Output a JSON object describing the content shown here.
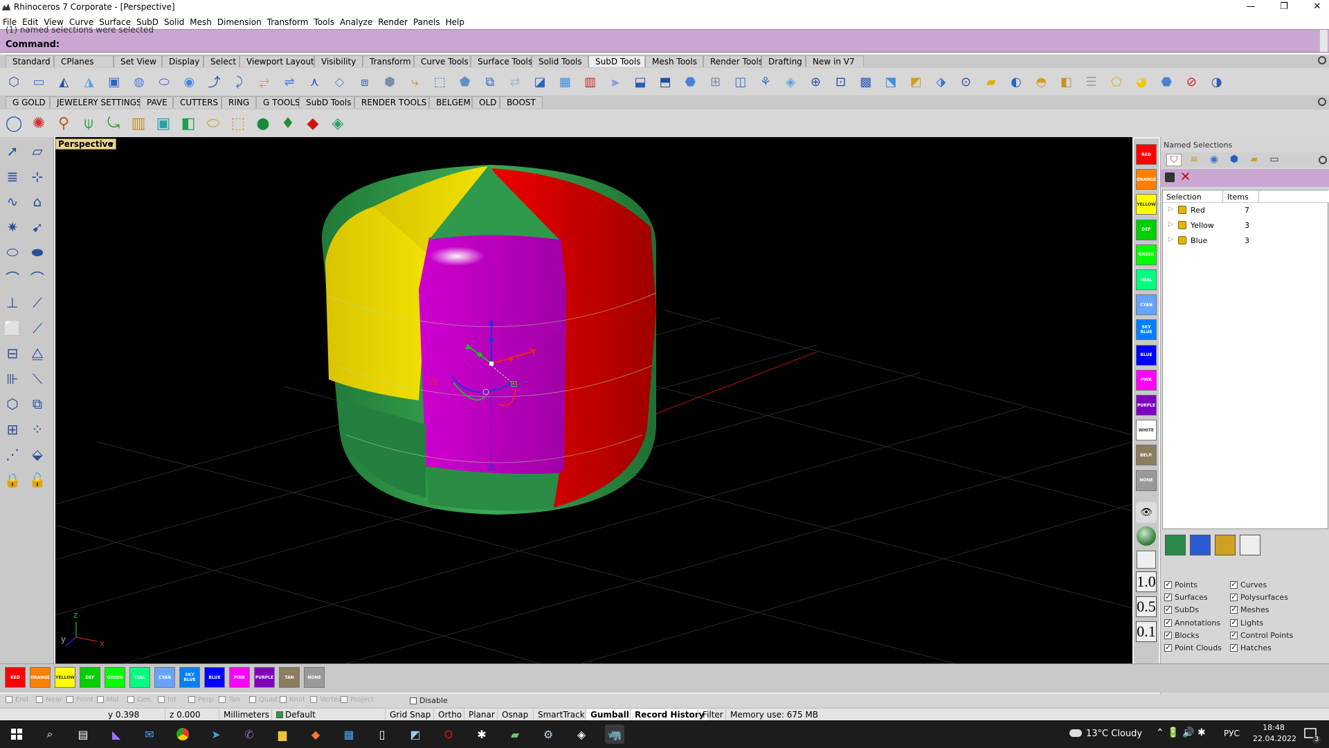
{
  "window": {
    "title": "Rhinoceros 7 Corporate - [Perspective]",
    "controls": [
      "—",
      "❐",
      "✕"
    ]
  },
  "menu": [
    "File",
    "Edit",
    "View",
    "Curve",
    "Surface",
    "SubD",
    "Solid",
    "Mesh",
    "Dimension",
    "Transform",
    "Tools",
    "Analyze",
    "Render",
    "Panels",
    "Help"
  ],
  "command": {
    "history": "(1) named selections were selected",
    "prompt": "Command:"
  },
  "toolbar_tabs_1": [
    "Standard",
    "CPlanes",
    "Set View",
    "Display",
    "Select",
    "Viewport Layout",
    "Visibility",
    "Transform",
    "Curve Tools",
    "Surface Tools",
    "Solid Tools",
    "SubD Tools",
    "Mesh Tools",
    "Render Tools",
    "Drafting",
    "New in V7"
  ],
  "toolbar_tabs_1_active": "SubD Tools",
  "toolbar_tabs_2": [
    "G GOLD",
    "JEWELERY SETTINGS",
    "PAVE",
    "CUTTERS",
    "RING",
    "G TOOLS",
    "SubD Tools",
    "RENDER TOOLS",
    "BELGEM",
    "OLD",
    "BOOST"
  ],
  "icon_row_1": [
    "subd-box-icon",
    "subd-plane-icon",
    "subd-cone-icon",
    "subd-pyramid-icon",
    "subd-cylinder-icon",
    "subd-sphere-icon",
    "subd-torus-icon",
    "subd-ellipsoid-icon",
    "subd-tube-icon",
    "subd-loft-icon",
    "subd-sweep-icon",
    "subd-pipe-icon",
    "subd-bridge-icon",
    "subd-crease-icon",
    "subd-box-smooth-icon",
    "subd-subdivide-icon",
    "subd-insert-edge-icon",
    "subd-fill-icon",
    "subd-stitch-icon",
    "subd-append-icon",
    "subd-mesh-icon",
    "subd-weld-icon",
    "subd-grid-icon",
    "subd-grid2-icon",
    "subd-transform-icon",
    "subd-extrude-icon",
    "subd-offset-icon",
    "subd-slide-icon",
    "subd-bevel-icon",
    "subd-symmetry-icon",
    "subd-patch-icon",
    "subd-reflect-icon",
    "subd-fill-hole-icon",
    "subd-grid3-icon",
    "subd-tools-icon",
    "subd-join-icon",
    "subd-unjoin-icon",
    "subd-merge-icon",
    "subd-box-display-icon",
    "subd-brush-icon",
    "subd-globe-icon",
    "subd-smooth-icon",
    "subd-paint-icon",
    "subd-stack-icon",
    "subd-face-icon",
    "subd-face2-icon",
    "subd-vertex-icon",
    "subd-no-icon",
    "subd-toggle-icon",
    "subd-bulge-icon"
  ],
  "icon_row_2": [
    "ring-icon",
    "bead-icon",
    "pin-icon",
    "prong-icon",
    "curve-tool-icon",
    "cylinder-gold-icon",
    "square-icon",
    "layers-icon",
    "oval-icon",
    "dotted-oval-icon",
    "sphere-green-icon",
    "gem-icon",
    "ruby-icon",
    "jewel-icon"
  ],
  "left_palette": [
    "select-arrow-icon",
    "eraser-icon",
    "layers-icon",
    "gumball-icon",
    "curve-icon",
    "surface-icon",
    "snap-icon",
    "move-icon",
    "ellipse-icon",
    "boolean-icon",
    "arc-icon",
    "arc2-icon",
    "line-icon",
    "bend-icon",
    "fillet-icon",
    "offset-icon",
    "trim-icon",
    "split-icon",
    "dimension-icon",
    "extend-icon",
    "polygon-icon",
    "array-icon",
    "grid-icon",
    "align-icon",
    "dim2-icon",
    "box2-icon",
    "lock-icon",
    "unlock-icon"
  ],
  "viewport": {
    "label": "Perspective",
    "dropdown_arrow": "▾",
    "axes": {
      "y": "y",
      "z": "z",
      "x": "x"
    },
    "colors": {
      "green": "#2e9a4b",
      "yellow": "#e6d100",
      "red": "#e00000",
      "magenta": "#cc00cc"
    }
  },
  "swatches_side": [
    {
      "label": "RED",
      "color": "#ff0000"
    },
    {
      "label": "ORANGE",
      "color": "#ff7f00"
    },
    {
      "label": "YELLOW",
      "color": "#ffff00"
    },
    {
      "label": "DEF",
      "color": "#00d000"
    },
    {
      "label": "GREEN",
      "color": "#00ff00"
    },
    {
      "label": "TEAL",
      "color": "#00ff80"
    },
    {
      "label": "CYAN",
      "color": "#66a3ff"
    },
    {
      "label": "SKY BLUE",
      "color": "#0080ff"
    },
    {
      "label": "BLUE",
      "color": "#0000ff"
    },
    {
      "label": "PINK",
      "color": "#ff00ff"
    },
    {
      "label": "PURPLE",
      "color": "#8000c0"
    },
    {
      "label": "WHITE",
      "color": "#ffffff"
    },
    {
      "label": "BELP.",
      "color": "#8b7d5e"
    },
    {
      "label": "NONE",
      "color": "#9a9a9a"
    }
  ],
  "zoom_buttons": [
    "1.0",
    "0.5",
    "0.1"
  ],
  "named_selections": {
    "title": "Named Selections",
    "columns": [
      "Selection",
      "Items"
    ],
    "rows": [
      {
        "name": "Red",
        "items": "7"
      },
      {
        "name": "Yellow",
        "items": "3"
      },
      {
        "name": "Blue",
        "items": "3"
      }
    ],
    "tool_icons": [
      "named-selection-icon",
      "list-icon",
      "color-wheel-icon",
      "material-icon",
      "folder-icon",
      "monitor-icon"
    ],
    "action_icons": [
      "save-icon",
      "delete-icon"
    ]
  },
  "filter_icons": [
    "filter-surface-icon",
    "filter-mesh-icon",
    "filter-curve-icon",
    "filter-points-icon"
  ],
  "filters_left": [
    "Points",
    "Surfaces",
    "SubDs",
    "Annotations",
    "Blocks",
    "Point Clouds"
  ],
  "filters_right": [
    "Curves",
    "Polysurfaces",
    "Meshes",
    "Lights",
    "Control Points",
    "Hatches"
  ],
  "swatches_bottom": [
    {
      "label": "RED",
      "color": "#ff0000"
    },
    {
      "label": "ORANGE",
      "color": "#ff7f00"
    },
    {
      "label": "YELLOW",
      "color": "#ffff00"
    },
    {
      "label": "DEF",
      "color": "#00d000"
    },
    {
      "label": "GREEN",
      "color": "#00ff00"
    },
    {
      "label": "TEAL",
      "color": "#00ff80"
    },
    {
      "label": "CYAN",
      "color": "#66a3ff"
    },
    {
      "label": "SKY BLUE",
      "color": "#0080ff"
    },
    {
      "label": "BLUE",
      "color": "#0000ff"
    },
    {
      "label": "PINK",
      "color": "#ff00ff"
    },
    {
      "label": "PURPLE",
      "color": "#8000c0"
    },
    {
      "label": "TAN",
      "color": "#8b7d5e"
    },
    {
      "label": "NONE",
      "color": "#9a9a9a"
    }
  ],
  "osnap": {
    "items": [
      "End",
      "Near",
      "Point",
      "Mid",
      "Cen",
      "Int",
      "Perp",
      "Tan",
      "Quad",
      "Knot",
      "Vertex",
      "Project"
    ],
    "disable": "Disable"
  },
  "status": {
    "y": "y 0.398",
    "z": "z 0.000",
    "units": "Millimeters",
    "layer": "Default",
    "layer_color": "#2e9a4b",
    "items": [
      "Grid Snap",
      "Ortho",
      "Planar",
      "Osnap",
      "SmartTrack",
      "Gumball",
      "Record History",
      "Filter"
    ],
    "active": [
      "Gumball",
      "Record History"
    ],
    "memory": "Memory use: 675 MB"
  },
  "taskbar": {
    "weather": "13°C Cloudy",
    "lang": "РУС",
    "time": "18:48",
    "date": "22.04.2022",
    "notifications": "3"
  }
}
